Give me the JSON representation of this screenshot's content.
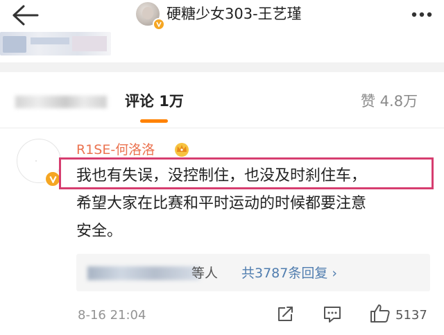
{
  "header": {
    "title": "硬糖少女303-王艺瑾"
  },
  "tabs": {
    "comments_label": "评论 1万",
    "likes_label": "赞 4.8万"
  },
  "comment": {
    "username": "R1SE-何洛洛",
    "text_lines": [
      "我也有失误，没控制住，也没及时刹住车，",
      "希望大家在比赛和平时运动的时候都要注意",
      "安全。"
    ],
    "replies": {
      "who_suffix": "等人",
      "count_link": "共3787条回复 ›"
    },
    "timestamp": "8-16 21:04",
    "like_count": "5137"
  },
  "colors": {
    "accent_orange": "#ff8200",
    "username_orange": "#eb7350",
    "link_blue": "#507daf",
    "highlight_box": "#d63d6f",
    "verified_badge": "#f5a623"
  },
  "icons": {
    "back": "back-arrow-icon",
    "more": "more-horizontal-icon",
    "verified": "verified-v-icon",
    "crown": "crown-icon",
    "share": "share-icon",
    "reply": "comment-icon",
    "like": "thumbs-up-icon"
  }
}
